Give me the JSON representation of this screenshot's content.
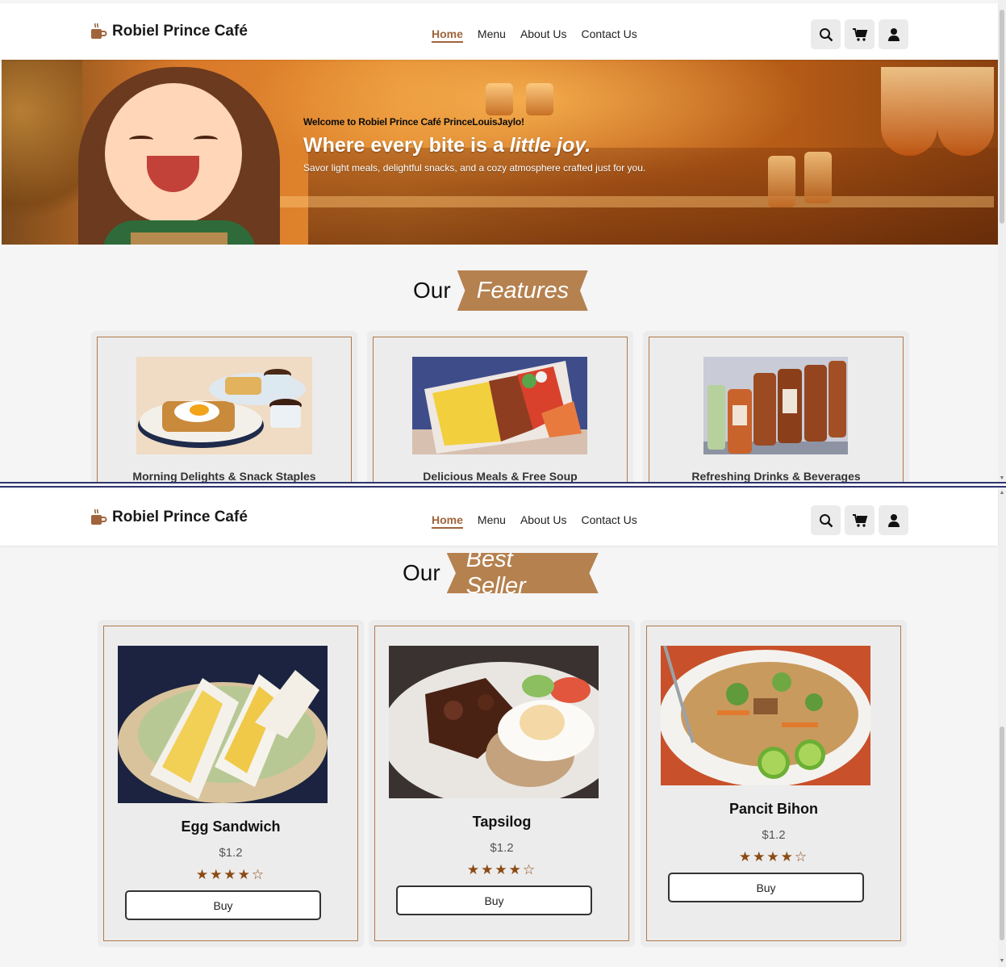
{
  "brand": {
    "name": "Robiel Prince Café",
    "icon": "coffee-cup-icon"
  },
  "nav": {
    "links": [
      {
        "label": "Home",
        "active": true
      },
      {
        "label": "Menu",
        "active": false
      },
      {
        "label": "About Us",
        "active": false
      },
      {
        "label": "Contact Us",
        "active": false
      }
    ],
    "icons": [
      "search-icon",
      "cart-icon",
      "user-icon"
    ]
  },
  "hero": {
    "welcome": "Welcome to Robiel Prince Café PrinceLouisJaylo!",
    "title_part1": "Where every bite is a ",
    "title_emphasis": "little joy.",
    "subtitle": "Savor light meals, delightful snacks, and a cozy atmosphere crafted just for you."
  },
  "features_section": {
    "heading_plain": "Our",
    "heading_ribbon": "Features",
    "cards": [
      {
        "label": "Morning Delights & Snack Staples"
      },
      {
        "label": "Delicious Meals & Free Soup"
      },
      {
        "label": "Refreshing Drinks & Beverages"
      }
    ]
  },
  "bestseller_section": {
    "heading_plain": "Our",
    "heading_ribbon": "Best Seller",
    "items": [
      {
        "name": "Egg Sandwich",
        "price": "$1.2",
        "stars": "★★★★☆",
        "rating": 4,
        "button": "Buy"
      },
      {
        "name": "Tapsilog",
        "price": "$1.2",
        "stars": "★★★★☆",
        "rating": 4,
        "button": "Buy"
      },
      {
        "name": "Pancit Bihon",
        "price": "$1.2",
        "stars": "★★★★☆",
        "rating": 4,
        "button": "Buy"
      }
    ]
  },
  "colors": {
    "accent": "#a0643c",
    "ribbon": "#b5814f",
    "frame_border": "#4b4b96"
  }
}
